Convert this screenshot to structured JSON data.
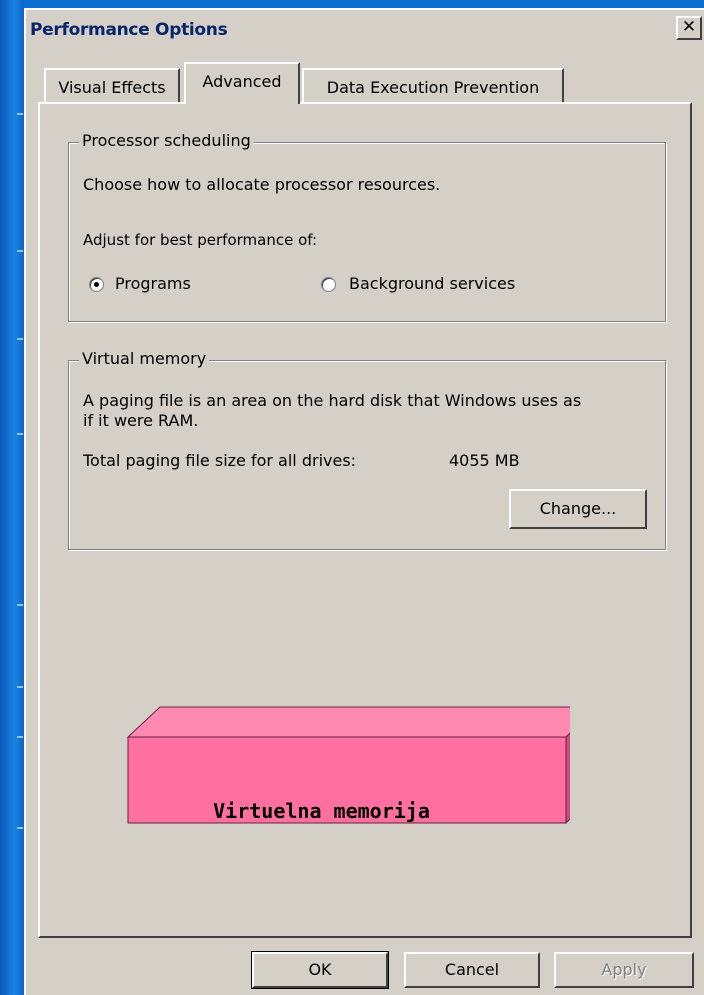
{
  "window": {
    "title": "Performance Options",
    "close_glyph": "✕"
  },
  "tabs": [
    {
      "label": "Visual Effects",
      "selected": false
    },
    {
      "label": "Advanced",
      "selected": true
    },
    {
      "label": "Data Execution Prevention",
      "selected": false
    }
  ],
  "processor_scheduling": {
    "title": "Processor scheduling",
    "description": "Choose how to allocate processor resources.",
    "adjust_label": "Adjust for best performance of:",
    "options": [
      {
        "label": "Programs",
        "selected": true
      },
      {
        "label": "Background services",
        "selected": false
      }
    ]
  },
  "virtual_memory": {
    "title": "Virtual memory",
    "description_line1": "A paging file is an area on the hard disk that Windows uses as",
    "description_line2": "if it were RAM.",
    "total_label": "Total paging file size for all drives:",
    "total_value": "4055 MB",
    "change_label": "Change..."
  },
  "callout": {
    "text": "Virtuelna memorija",
    "front_color": "#ff6fa0",
    "top_color": "#ff89b0",
    "side_color": "#c94c7a"
  },
  "footer": {
    "ok_label": "OK",
    "cancel_label": "Cancel",
    "apply_label": "Apply"
  },
  "colors": {
    "desktop": "#0b6fd1",
    "dialog": "#d4d0c8",
    "title_text": "#0a246a"
  }
}
